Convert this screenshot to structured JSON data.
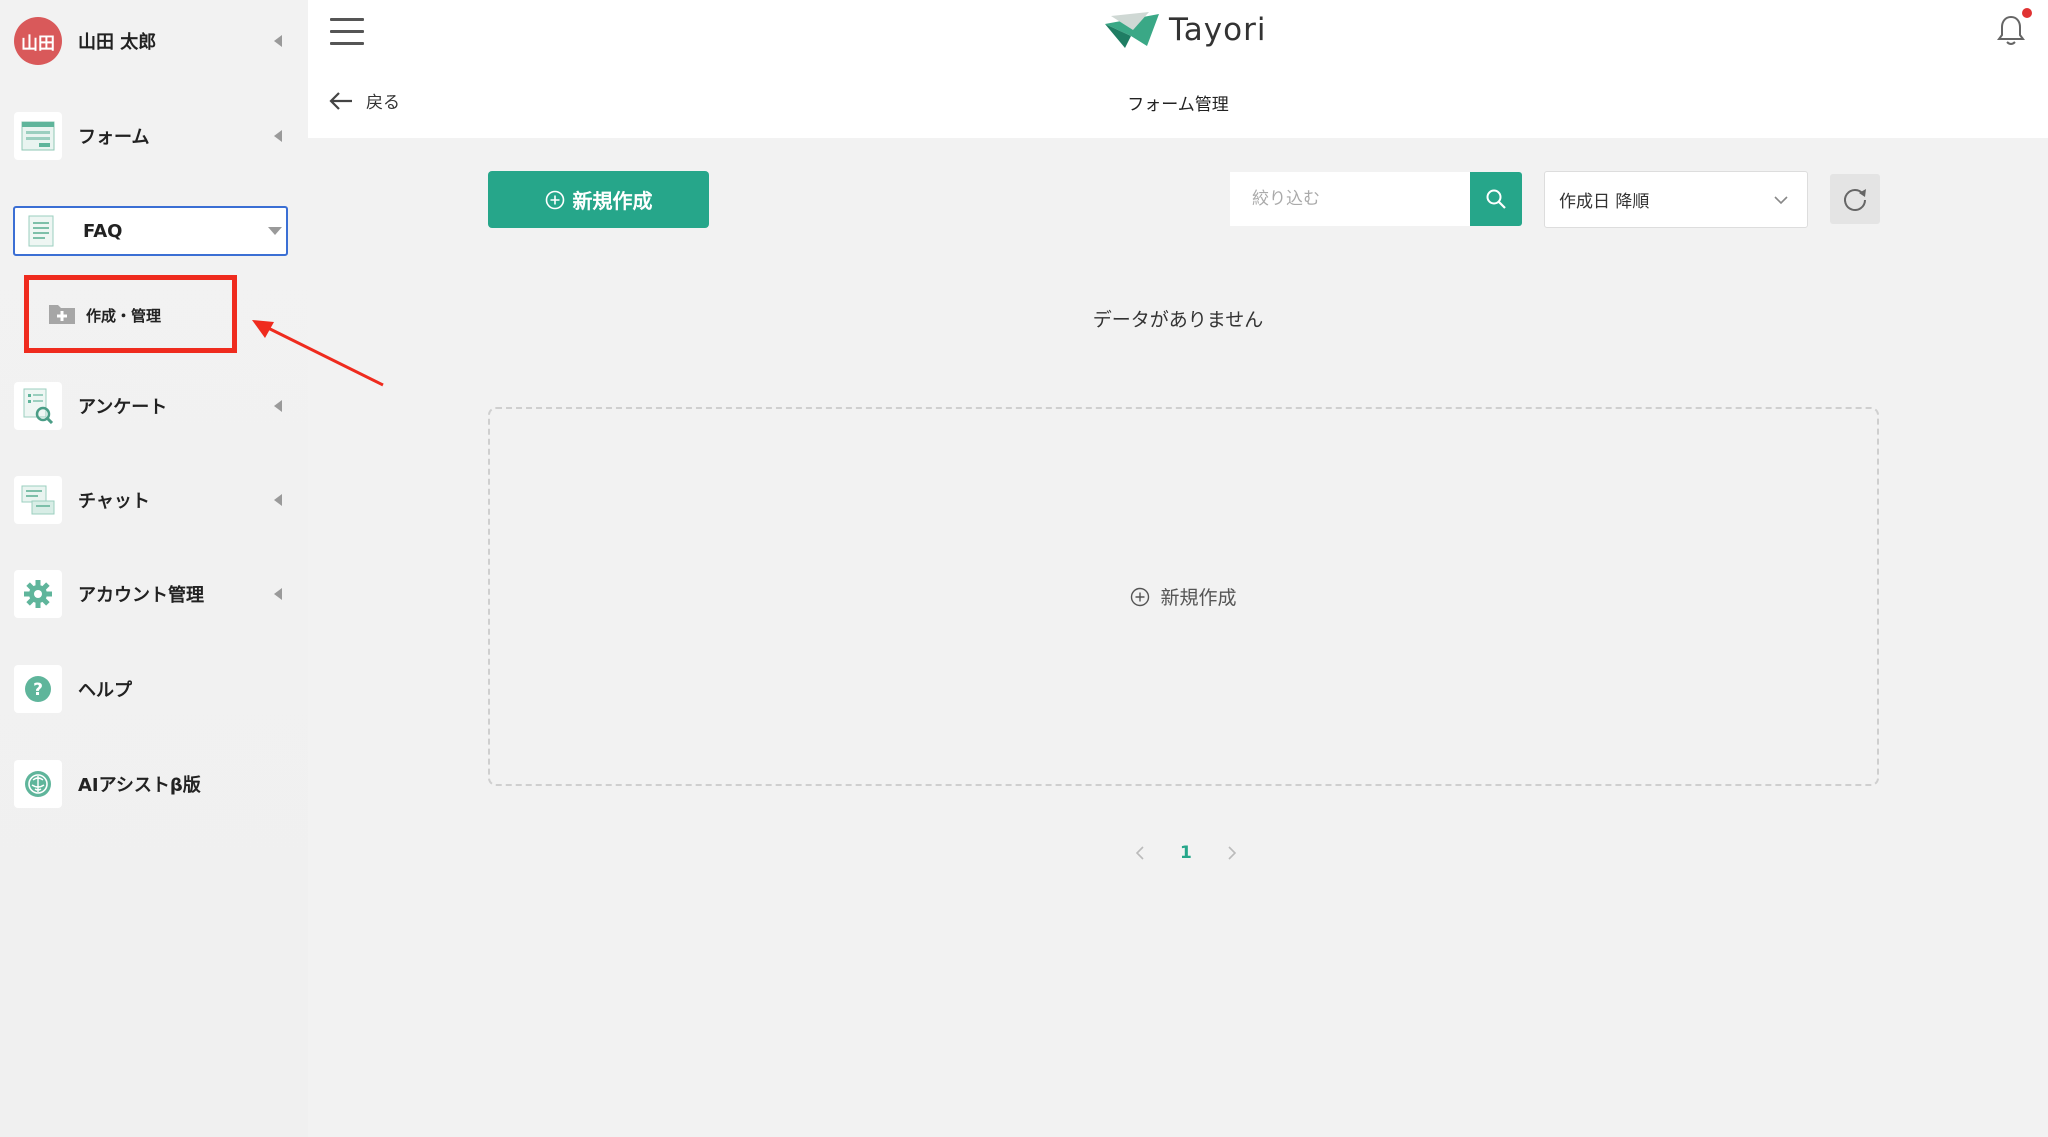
{
  "sidebar": {
    "user": {
      "avatar_text": "山田",
      "name": "山田 太郎"
    },
    "items": [
      {
        "label": "フォーム",
        "icon": "form-icon"
      },
      {
        "label": "FAQ",
        "icon": "faq-icon"
      },
      {
        "label": "アンケート",
        "icon": "survey-icon"
      },
      {
        "label": "チャット",
        "icon": "chat-icon"
      },
      {
        "label": "アカウント管理",
        "icon": "gear-icon"
      },
      {
        "label": "ヘルプ",
        "icon": "help-icon"
      },
      {
        "label": "AIアシストβ版",
        "icon": "ai-icon"
      }
    ],
    "faq_sub": {
      "label": "作成・管理",
      "icon": "folder-plus-icon"
    }
  },
  "header": {
    "logo_text": "Tayori",
    "back_label": "戻る",
    "page_title": "フォーム管理"
  },
  "toolbar": {
    "new_label": "新規作成",
    "search_placeholder": "絞り込む",
    "sort_value": "作成日 降順"
  },
  "main": {
    "empty_text": "データがありません",
    "drop_label": "新規作成"
  },
  "pagination": {
    "current": "1"
  },
  "colors": {
    "accent": "#26a68a",
    "highlight": "#ef2b1e",
    "avatar": "#d9595a"
  }
}
